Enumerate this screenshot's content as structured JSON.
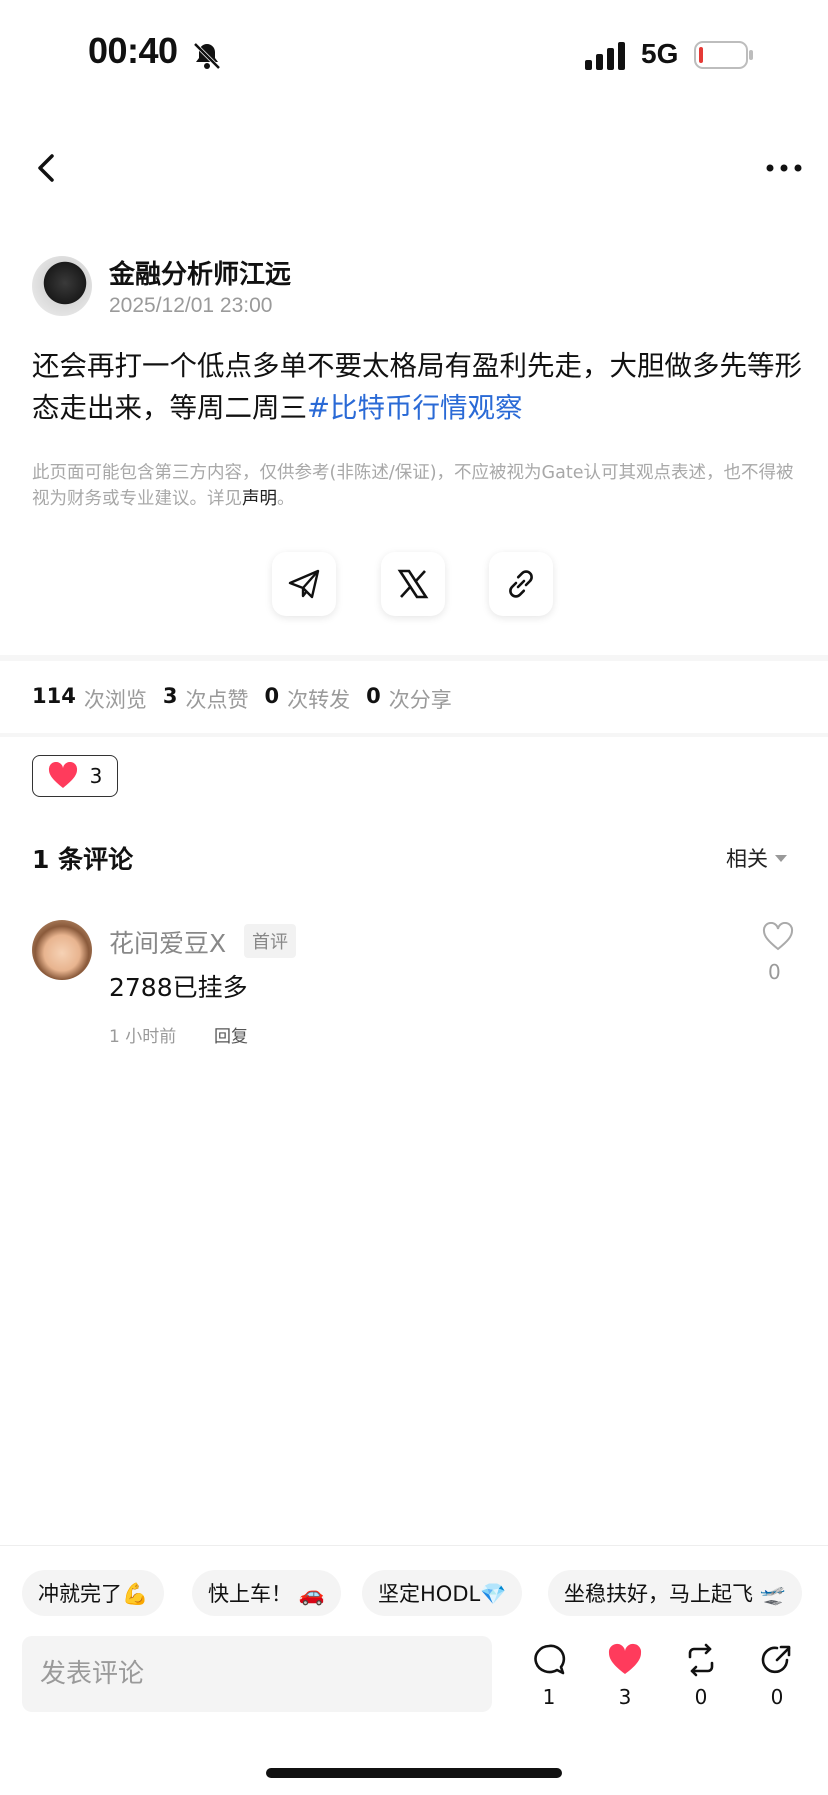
{
  "status_bar": {
    "time": "00:40",
    "network": "5G"
  },
  "author": {
    "name": "金融分析师江远",
    "timestamp": "2025/12/01 23:00"
  },
  "post": {
    "text": "还会再打一个低点多单不要太格局有盈利先走，大胆做多先等形态走出来，等周二周三",
    "hashtag": "#比特币行情观察"
  },
  "disclaimer": {
    "text": "此页面可能包含第三方内容，仅供参考(非陈述/保证)，不应被视为Gate认可其观点表述，也不得被视为财务或专业建议。详见",
    "link": "声明",
    "suffix": "。"
  },
  "stats": {
    "views": "114",
    "views_label": "次浏览",
    "likes": "3",
    "likes_label": "次点赞",
    "reposts": "0",
    "reposts_label": "次转发",
    "shares": "0",
    "shares_label": "次分享"
  },
  "reaction": {
    "count": "3"
  },
  "comments": {
    "title": "1 条评论",
    "sort_label": "相关",
    "items": [
      {
        "user": "花间爱豆X",
        "tag": "首评",
        "text": "2788已挂多",
        "time": "1 小时前",
        "reply_label": "回复",
        "likes": "0"
      }
    ]
  },
  "quick_replies": [
    "冲就完了💪",
    "快上车！ 🚗",
    "坚定HODL💎",
    "坐稳扶好，马上起飞 🛫"
  ],
  "composer": {
    "placeholder": "发表评论"
  },
  "actions": {
    "comments": "1",
    "likes": "3",
    "reposts": "0",
    "shares": "0"
  },
  "colors": {
    "accent": "#2a6ad6",
    "like": "#ff3b5c",
    "battery_low": "#e53935"
  }
}
